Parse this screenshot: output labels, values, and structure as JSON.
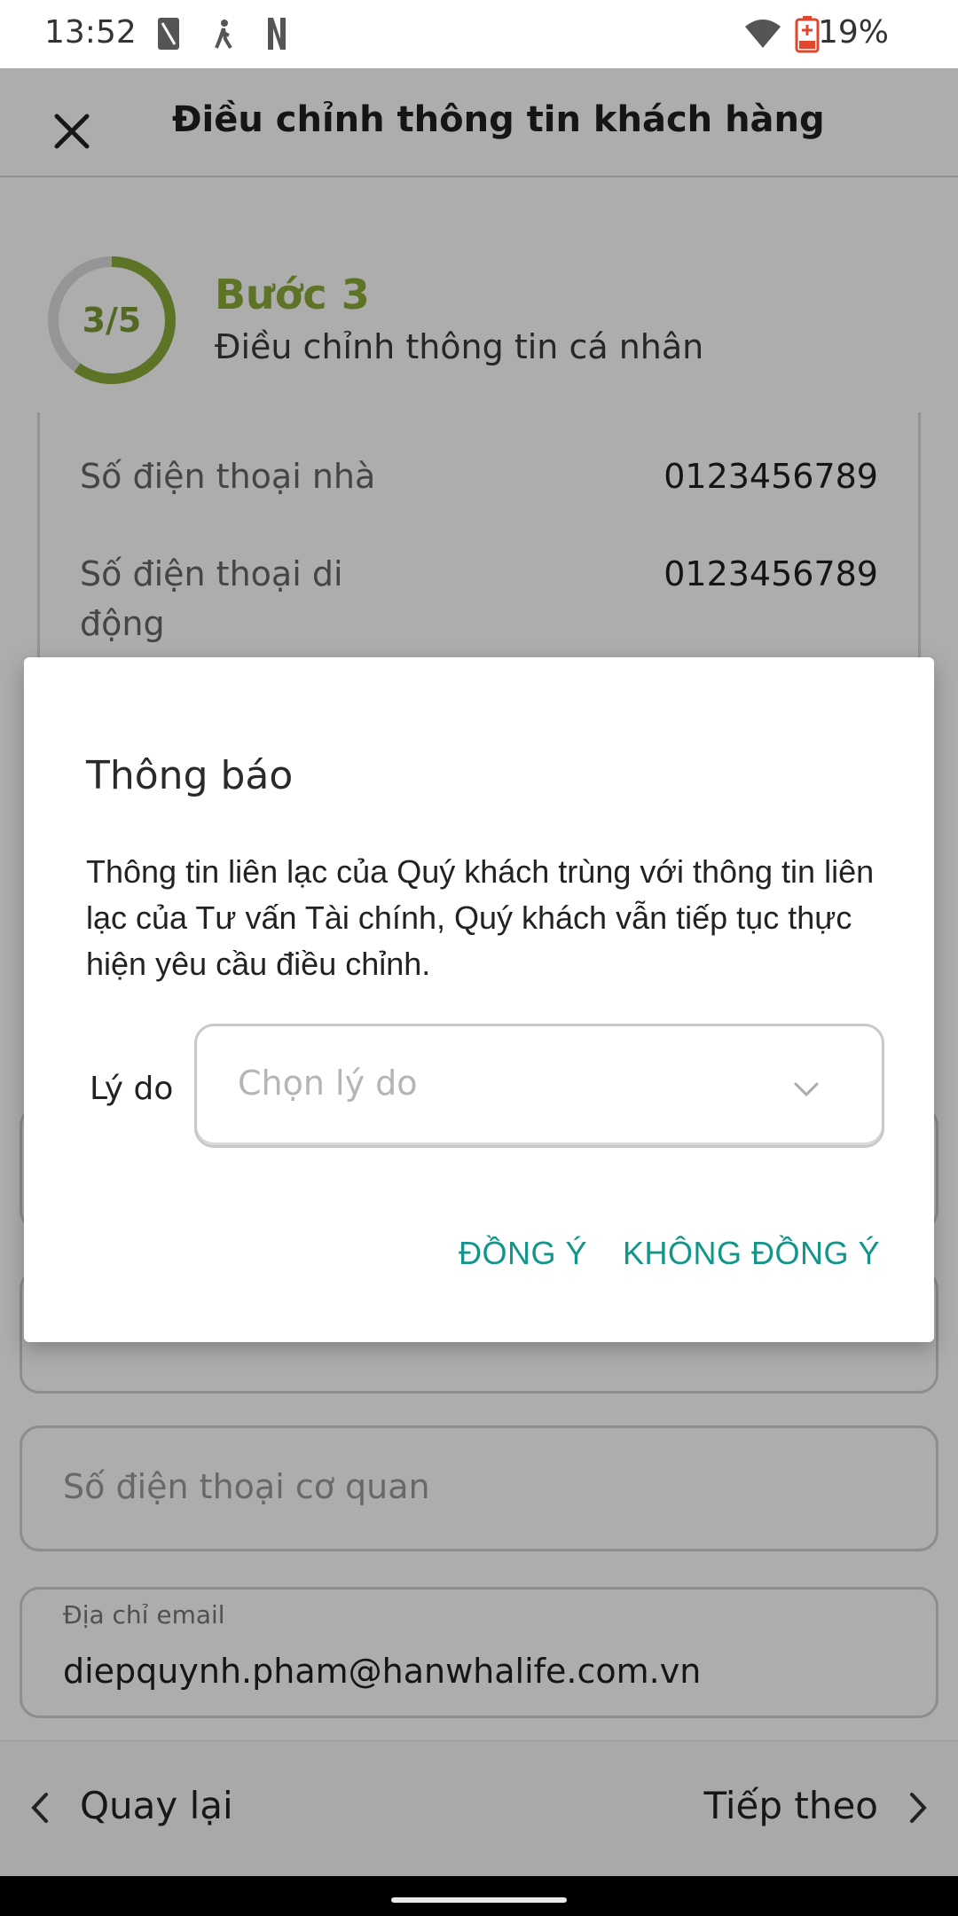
{
  "status_bar": {
    "time": "13:52",
    "battery_percent": "19%",
    "icons": [
      "sim-card-icon",
      "person-walking-icon",
      "netflix-icon",
      "wifi-icon",
      "battery-low-icon"
    ]
  },
  "header": {
    "title": "Điều chỉnh thông tin khách hàng",
    "close_icon": "close-icon"
  },
  "step": {
    "count": "3/5",
    "progress": 0.6,
    "title": "Bước 3",
    "subtitle": "Điều chỉnh thông tin cá nhân",
    "accent_color": "#8aab38"
  },
  "info_card": {
    "rows": [
      {
        "label": "Số điện thoại nhà",
        "value": "0123456789"
      },
      {
        "label": "Số điện thoại di động",
        "value": "0123456789"
      }
    ]
  },
  "form": {
    "office_phone_placeholder": "Số điện thoại cơ quan",
    "email_label": "Địa chỉ email",
    "email_value": "diepquynh.pham@hanwhalife.com.vn"
  },
  "footer": {
    "back_label": "Quay lại",
    "next_label": "Tiếp theo"
  },
  "dialog": {
    "title": "Thông báo",
    "message": "Thông tin liên lạc của Quý khách trùng với thông tin liên lạc của Tư vấn Tài chính, Quý khách vẫn tiếp tục thực hiện yêu cầu điều chỉnh.",
    "reason_label": "Lý do",
    "reason_placeholder": "Chọn lý do",
    "agree_label": "ĐỒNG Ý",
    "disagree_label": "KHÔNG ĐỒNG Ý",
    "button_color": "#13958a"
  }
}
